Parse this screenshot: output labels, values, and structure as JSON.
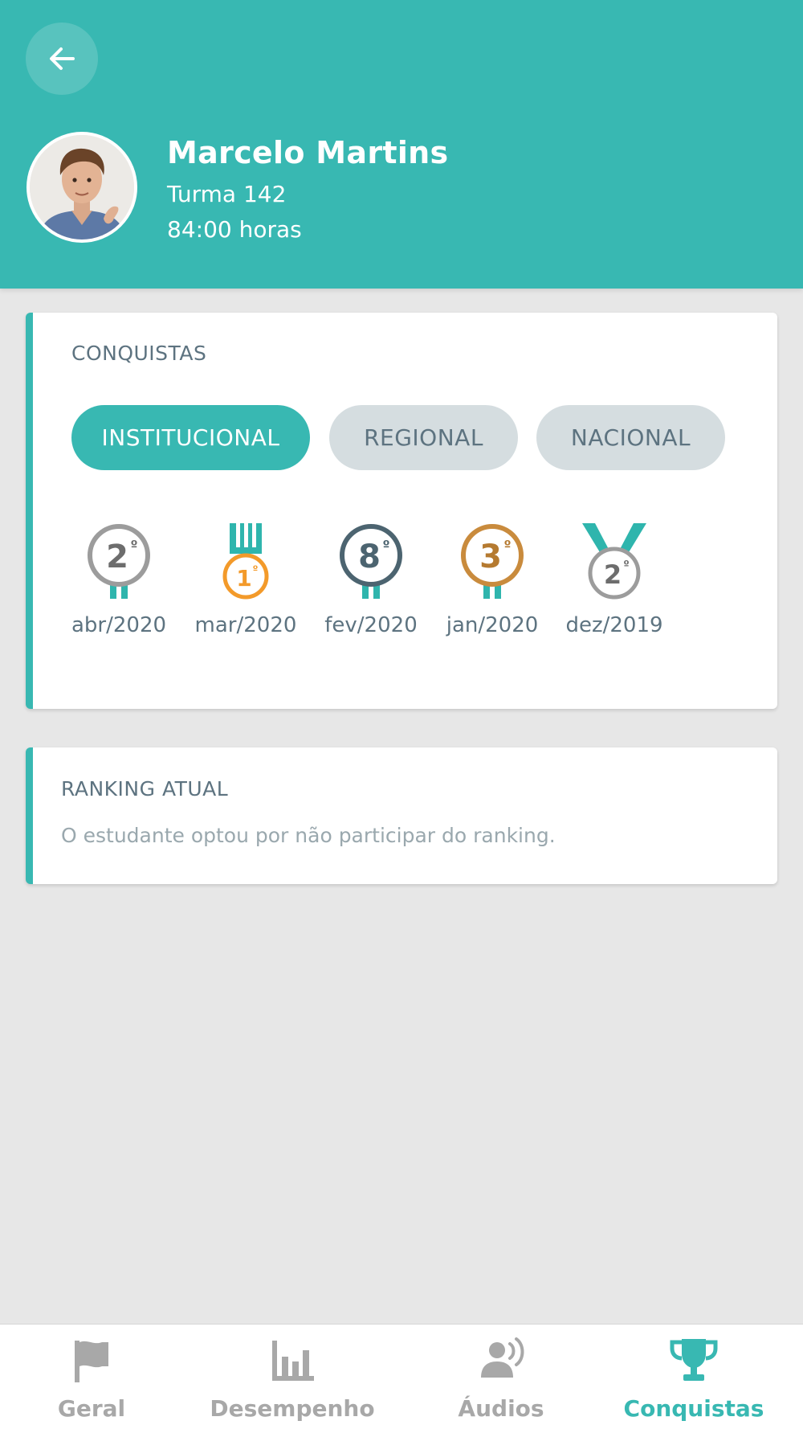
{
  "profile": {
    "name": "Marcelo Martins",
    "class": "Turma 142",
    "hours": "84:00 horas"
  },
  "achievements": {
    "title": "CONQUISTAS",
    "tabs": [
      {
        "label": "INSTITUCIONAL",
        "active": true
      },
      {
        "label": "REGIONAL",
        "active": false
      },
      {
        "label": "NACIONAL",
        "active": false
      }
    ],
    "medals": [
      {
        "place": "2",
        "ordinal": "º",
        "date": "abr/2020",
        "color": "#6d6d6d",
        "icon": "silver-medal-icon"
      },
      {
        "place": "1",
        "ordinal": "º",
        "date": "mar/2020",
        "color": "#f39a2a",
        "icon": "gold-medal-icon"
      },
      {
        "place": "8",
        "ordinal": "º",
        "date": "fev/2020",
        "color": "#4c6470",
        "icon": "ranking-badge-icon"
      },
      {
        "place": "3",
        "ordinal": "º",
        "date": "jan/2020",
        "color": "#b57a30",
        "icon": "bronze-medal-icon"
      },
      {
        "place": "2",
        "ordinal": "º",
        "date": "dez/2019",
        "color": "#6d6d6d",
        "icon": "silver-medal-icon"
      }
    ]
  },
  "ranking": {
    "title": "RANKING ATUAL",
    "message": "O estudante optou por não participar do ranking."
  },
  "nav": {
    "items": [
      {
        "label": "Geral",
        "icon": "flag-icon",
        "active": false
      },
      {
        "label": "Desempenho",
        "icon": "bar-chart-icon",
        "active": false
      },
      {
        "label": "Áudios",
        "icon": "audio-speaker-icon",
        "active": false
      },
      {
        "label": "Conquistas",
        "icon": "trophy-icon",
        "active": true
      }
    ]
  },
  "colors": {
    "accent": "#38b8b2",
    "muted_text": "#5d7380",
    "inactive_nav": "#a8a8a8"
  }
}
